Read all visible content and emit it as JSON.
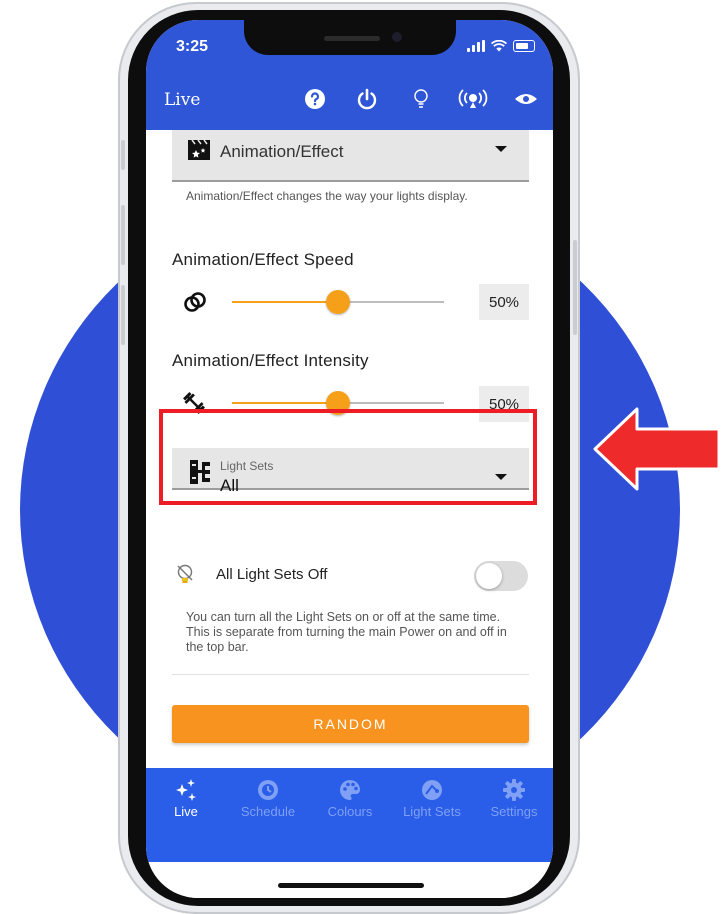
{
  "status": {
    "time": "3:25"
  },
  "header": {
    "title": "Live"
  },
  "effect": {
    "select_value": "Animation/Effect",
    "helper": "Animation/Effect changes the way your lights display."
  },
  "speed": {
    "heading": "Animation/Effect Speed",
    "percent_text": "50%",
    "level": 0.5
  },
  "intensity": {
    "heading": "Animation/Effect Intensity",
    "percent_text": "50%",
    "level": 0.5
  },
  "light_sets": {
    "label": "Light Sets",
    "value": "All"
  },
  "all_off": {
    "label": "All Light Sets Off",
    "toggle_on": false,
    "helper": "You can turn all the Light Sets on or off at the same time. This is separate from turning the main Power on and off in the top bar."
  },
  "random_button": "RANDOM",
  "tabs": [
    {
      "label": "Live",
      "icon": "sparkles-icon",
      "active": true
    },
    {
      "label": "Schedule",
      "icon": "schedule-icon",
      "active": false
    },
    {
      "label": "Colours",
      "icon": "palette-icon",
      "active": false
    },
    {
      "label": "Light Sets",
      "icon": "light-sets-icon",
      "active": false
    },
    {
      "label": "Settings",
      "icon": "gear-icon",
      "active": false
    }
  ],
  "colors": {
    "app_blue": "#2f56d6",
    "tab_blue": "#2a5de8",
    "accent_orange": "#f7931e",
    "highlight_red": "#ee1c24",
    "background_circle": "#2f4fd6"
  }
}
